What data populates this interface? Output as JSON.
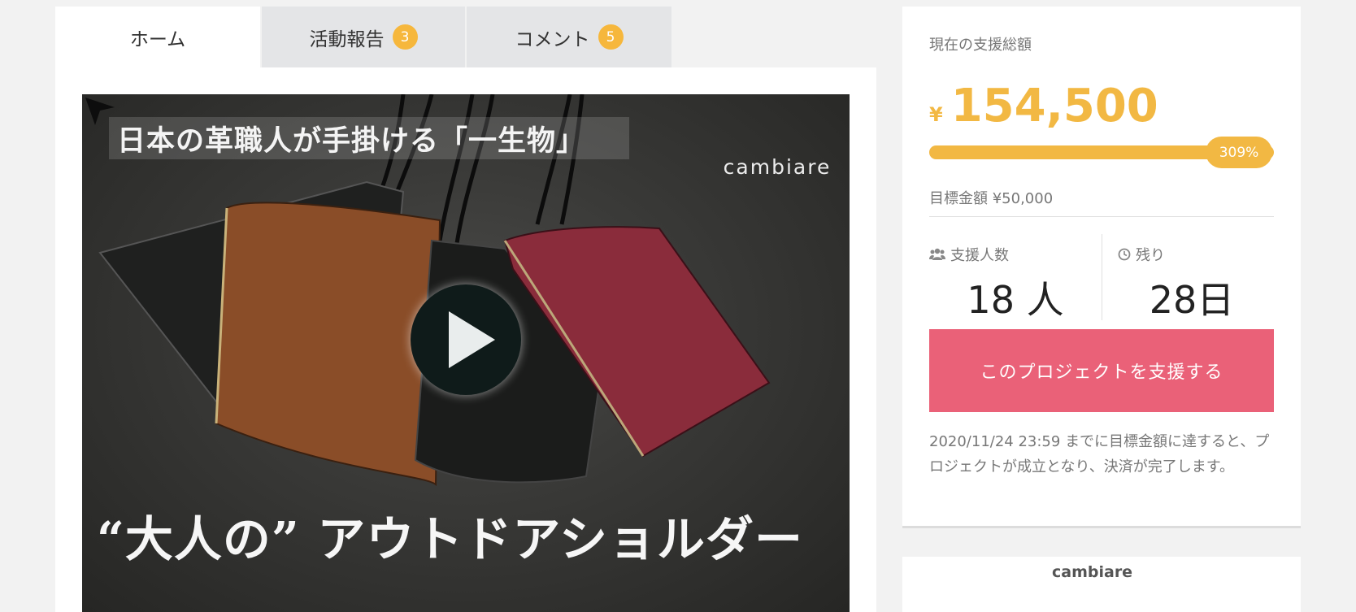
{
  "tabs": [
    {
      "label": "ホーム",
      "badge": ""
    },
    {
      "label": "活動報告",
      "badge": "3"
    },
    {
      "label": "コメント",
      "badge": "5"
    }
  ],
  "hero": {
    "banner_text": "日本の革職人が手掛ける「一生物」",
    "brand": "cambiare",
    "tagline": "“大人の” アウトドアショルダー"
  },
  "funding": {
    "label": "現在の支援総額",
    "currency": "¥",
    "amount": "154,500",
    "progress_fraction": 1.0,
    "percent_label": "309%",
    "goal": "目標金額 ¥50,000",
    "supporters_label": "支援人数",
    "supporters_value": "18 人",
    "remaining_label": "残り",
    "remaining_value": "28日",
    "support_button": "このプロジェクトを支援する",
    "note": "2020/11/24 23:59 までに目標金額に達すると、プロジェクトが成立となり、決済が完了します。"
  },
  "owner": {
    "name": "cambiare"
  },
  "colors": {
    "accent": "#f2b843",
    "button": "#ea6178",
    "badge": "#f6b73c"
  }
}
